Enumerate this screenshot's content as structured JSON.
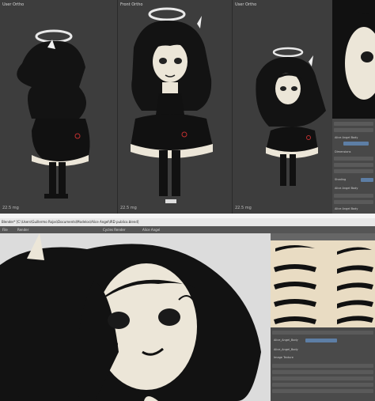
{
  "viewports": [
    {
      "label": "User Ortho",
      "units": "22.5 mg"
    },
    {
      "label": "Front Ortho",
      "units": "22.5 mg"
    },
    {
      "label": "User Ortho",
      "units": "22.5 mg"
    }
  ],
  "window2_title": "Blender* [C:\\Users\\Guillermo Rojas\\Documents\\Modelos\\Alice Angel\\IRD publico.blend]",
  "menu": {
    "file": "File",
    "render": "Render",
    "engine": "Cycles Render",
    "shading": "Alice Angel"
  },
  "properties": {
    "label_1": "Alice Angel Body",
    "tab_1": "Dimensions",
    "tab_2": "Shading",
    "tab_3": "Alice Angel Body",
    "checkbox_1": "Alice Angel Body"
  },
  "uv_panel": {
    "image_label": "Alice_Angel_Body",
    "field_1": "Alice_Angel_Body",
    "field_2": "Image Texture"
  },
  "colors": {
    "bg": "#3a3a3a",
    "skin": "#ece6d8",
    "hair": "#121212",
    "texture_bg": "#e9dcc3",
    "accent": "#5d7ea5"
  }
}
